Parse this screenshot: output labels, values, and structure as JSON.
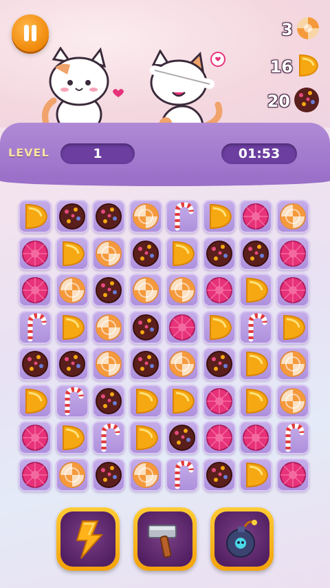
{
  "hud": {
    "level_label": "LEVEL",
    "level_value": "1",
    "timer": "01:53"
  },
  "goals": [
    {
      "candy": "lollipop",
      "count": "3"
    },
    {
      "candy": "lemon",
      "count": "16"
    },
    {
      "candy": "chocolate",
      "count": "20"
    }
  ],
  "board": {
    "rows": [
      [
        "lemon",
        "chocolate",
        "chocolate",
        "lollipop",
        "cane",
        "lemon",
        "gum",
        "lollipop"
      ],
      [
        "gum",
        "lemon",
        "lollipop",
        "chocolate",
        "lemon",
        "chocolate",
        "chocolate",
        "gum"
      ],
      [
        "gum",
        "lollipop",
        "chocolate",
        "lollipop",
        "lollipop",
        "gum",
        "lemon",
        "gum"
      ],
      [
        "cane",
        "lemon",
        "lollipop",
        "chocolate",
        "gum",
        "lemon",
        "cane",
        "lemon"
      ],
      [
        "chocolate",
        "chocolate",
        "lollipop",
        "chocolate",
        "lollipop",
        "chocolate",
        "lemon",
        "lollipop"
      ],
      [
        "lemon",
        "cane",
        "chocolate",
        "lemon",
        "lemon",
        "gum",
        "lemon",
        "lollipop"
      ],
      [
        "gum",
        "lemon",
        "cane",
        "lemon",
        "chocolate",
        "gum",
        "gum",
        "cane"
      ],
      [
        "gum",
        "lollipop",
        "chocolate",
        "lollipop",
        "cane",
        "chocolate",
        "lemon",
        "gum"
      ]
    ]
  },
  "boosters": [
    {
      "name": "lightning-booster"
    },
    {
      "name": "hammer-booster"
    },
    {
      "name": "bomb-booster"
    }
  ],
  "colors": {
    "lemon": "#f5a812",
    "gum": "#e7327a",
    "chocolate": "#5a1f1c",
    "lollipop": "#f59a3c",
    "cane": "#e23b3b"
  }
}
